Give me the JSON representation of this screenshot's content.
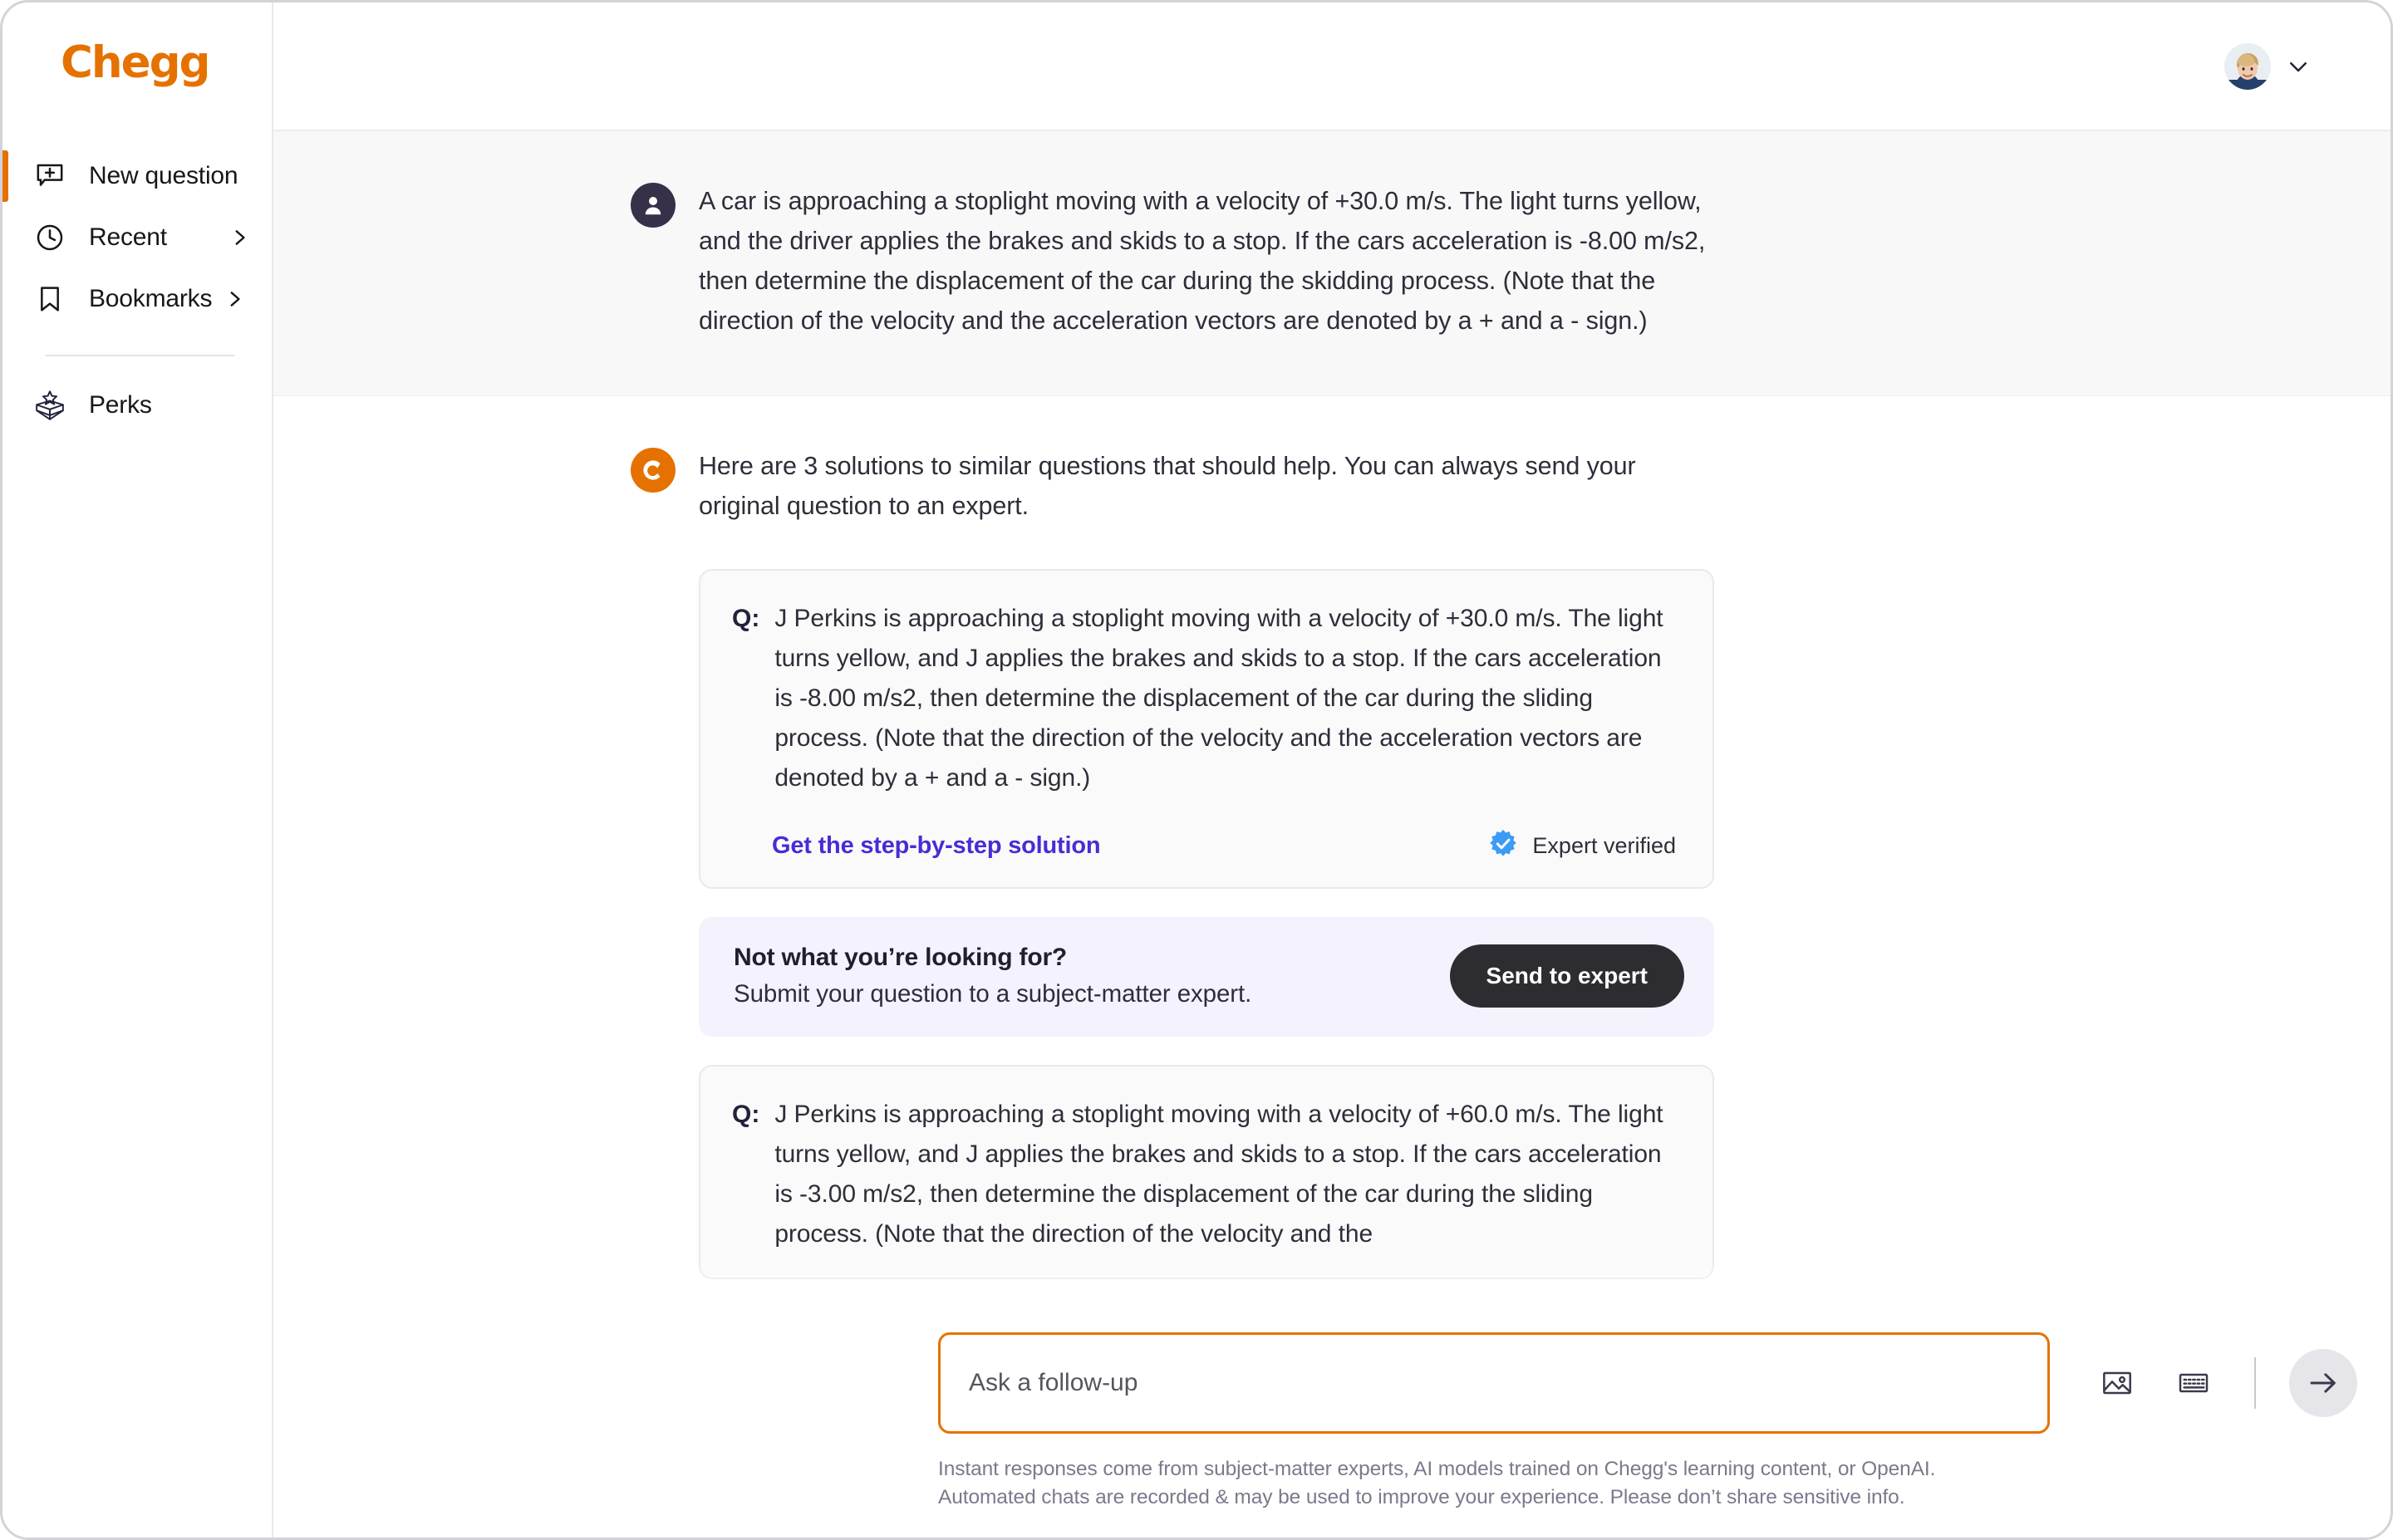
{
  "brand": {
    "name": "Chegg",
    "color": "#e57200"
  },
  "sidebar": {
    "items": [
      {
        "label": "New question",
        "icon": "new-question-icon",
        "active": true,
        "chevron": false
      },
      {
        "label": "Recent",
        "icon": "clock-icon",
        "active": false,
        "chevron": true
      },
      {
        "label": "Bookmarks",
        "icon": "bookmark-icon",
        "active": false,
        "chevron": true
      },
      {
        "label": "Perks",
        "icon": "gift-box-star-icon",
        "active": false,
        "chevron": false
      }
    ]
  },
  "topbar": {
    "avatar_alt": "user-profile-photo",
    "chevron": "chevron-down-icon"
  },
  "conversation": {
    "user_message": "A car is approaching a stoplight moving with a velocity of +30.0 m/s. The light turns yellow, and the driver applies the brakes and skids to a stop. If the cars acceleration is -8.00 m/s2, then determine the displacement of the car during the skidding process. (Note that the direction of the velocity and the acceleration vectors are denoted by a + and a - sign.)",
    "bot_message": "Here are 3 solutions to similar questions that should help. You can always send your original question to an expert.",
    "cards": [
      {
        "q_label": "Q:",
        "q_text": "J Perkins is approaching a stoplight moving with a velocity of +30.0 m/s. The light turns yellow, and J applies the brakes and skids to a stop. If the cars acceleration is -8.00 m/s2, then determine the displacement of the car during the sliding process. (Note that the direction of the velocity and the acceleration vectors are denoted by a + and a - sign.)",
        "link_label": "Get the step-by-step solution",
        "verified_label": "Expert verified",
        "verified_color": "#3b9cf5",
        "link_color": "#4a2bd4"
      }
    ],
    "expert_panel": {
      "title": "Not what you’re looking for?",
      "subtitle": "Submit your question to a subject-matter expert.",
      "button_label": "Send to expert"
    },
    "card2": {
      "q_label": "Q:",
      "q_text": "J Perkins is approaching a stoplight moving with a velocity of +60.0 m/s. The light turns yellow, and J applies the brakes and skids to a stop. If the cars acceleration is -3.00 m/s2, then determine the displacement of the car during the sliding process. (Note that the direction of the velocity and the"
    }
  },
  "composer": {
    "placeholder": "Ask a follow-up",
    "value": "",
    "image_icon": "image-upload-icon",
    "keyboard_icon": "keyboard-icon",
    "send_icon": "arrow-right-icon",
    "disclaimer_line1": "Instant responses come from subject-matter experts, AI models trained on Chegg's learning content, or OpenAI.",
    "disclaimer_line2": "Automated chats are recorded & may be used to improve your experience. Please don’t share sensitive info."
  }
}
